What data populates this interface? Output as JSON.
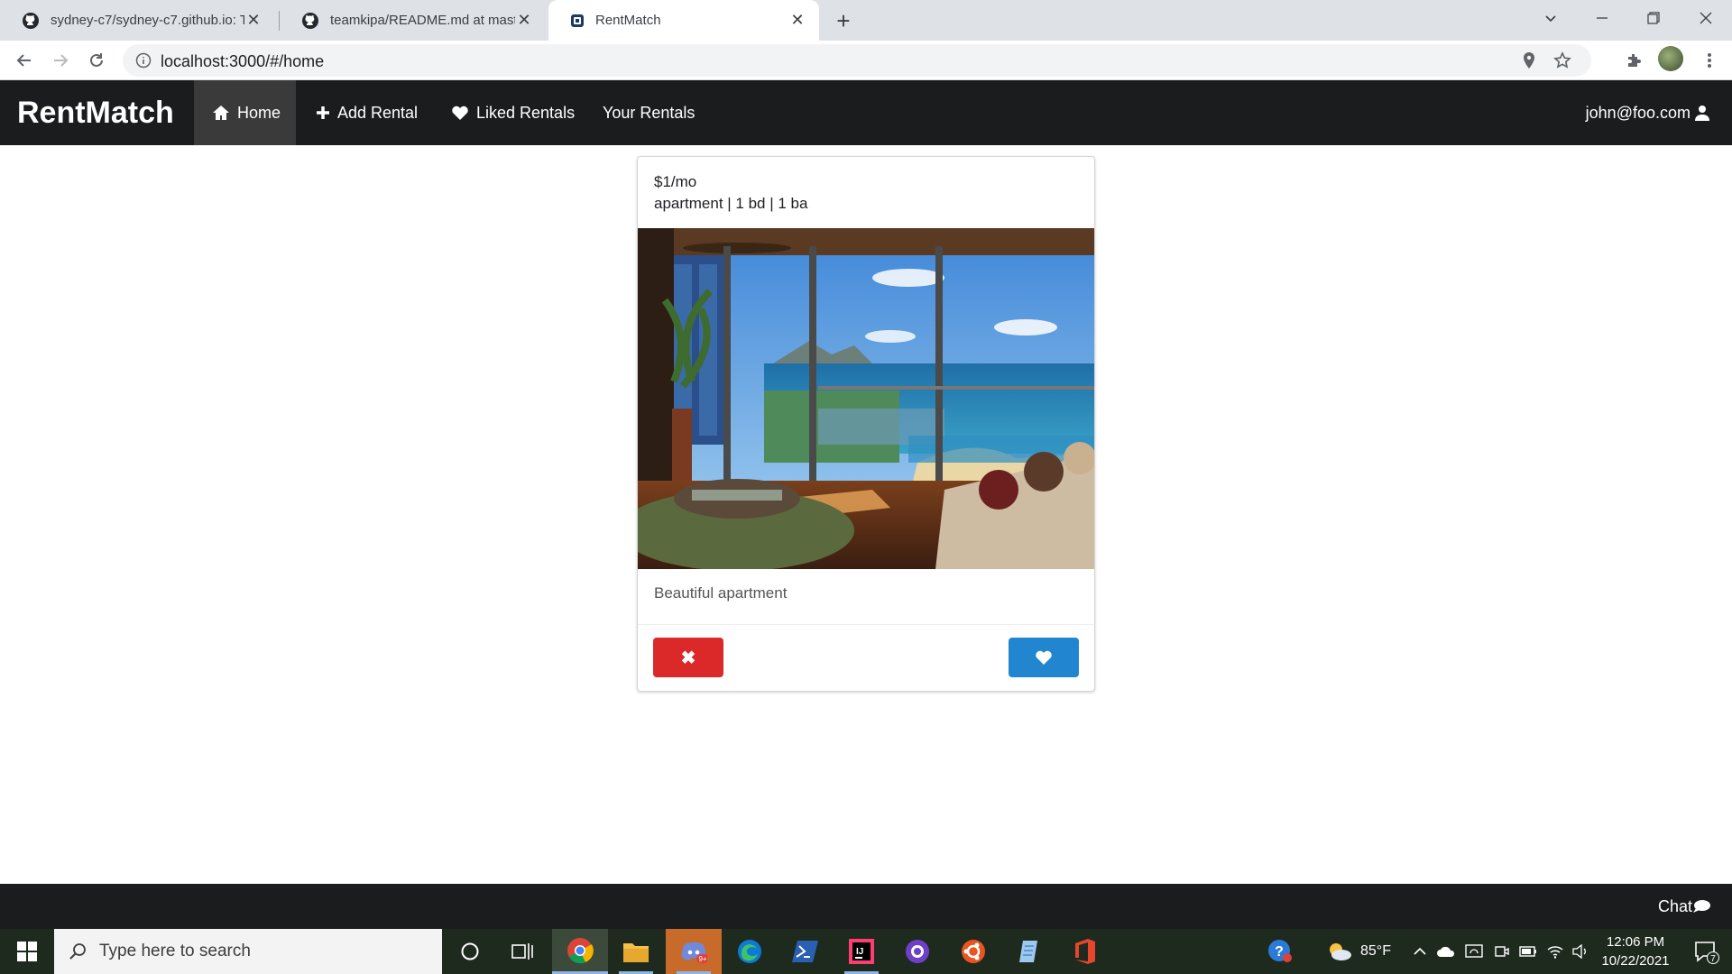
{
  "browser": {
    "tabs": [
      {
        "title": "sydney-c7/sydney-c7.github.io: T",
        "icon": "github-icon"
      },
      {
        "title": "teamkipa/README.md at master",
        "icon": "github-icon"
      },
      {
        "title": "RentMatch",
        "icon": "rentmatch-favicon",
        "active": true
      }
    ],
    "new_tab_label": "+",
    "url": "localhost:3000/#/home"
  },
  "navbar": {
    "brand": "RentMatch",
    "items": [
      {
        "label": "Home",
        "icon": "home-icon",
        "active": true
      },
      {
        "label": "Add Rental",
        "icon": "plus-icon"
      },
      {
        "label": "Liked Rentals",
        "icon": "heart-icon"
      },
      {
        "label": "Your Rentals"
      }
    ],
    "user": "john@foo.com"
  },
  "card": {
    "price": "$1/mo",
    "details": "apartment | 1 bd | 1 ba",
    "description": "Beautiful apartment",
    "reject_label": "✖",
    "like_icon": "heart-icon"
  },
  "footer": {
    "chat_label": "Chat"
  },
  "taskbar": {
    "search_placeholder": "Type here to search",
    "weather": "85°F",
    "time": "12:06 PM",
    "date": "10/22/2021",
    "notification_count": "7"
  },
  "colors": {
    "navbar_bg": "#1b1c1d",
    "reject_button": "#db2828",
    "like_button": "#2185d0"
  }
}
